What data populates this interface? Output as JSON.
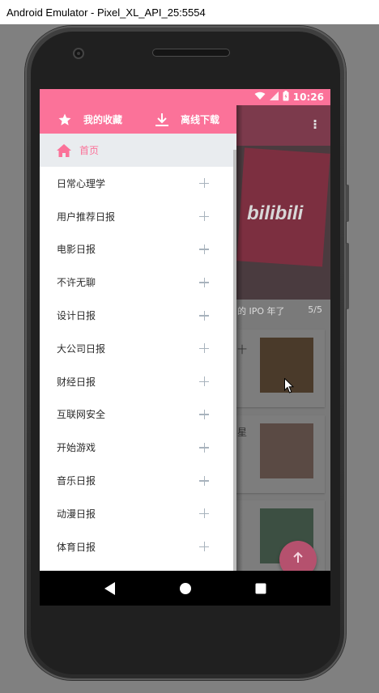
{
  "window": {
    "title": "Android Emulator - Pixel_XL_API_25:5554"
  },
  "statusbar": {
    "time": "10:26"
  },
  "drawer": {
    "header": {
      "favorites_label": "我的收藏",
      "offline_label": "离线下载"
    },
    "home_label": "首页",
    "items": [
      {
        "label": "日常心理学"
      },
      {
        "label": "用户推荐日报"
      },
      {
        "label": "电影日报"
      },
      {
        "label": "不许无聊"
      },
      {
        "label": "设计日报"
      },
      {
        "label": "大公司日报"
      },
      {
        "label": "财经日报"
      },
      {
        "label": "互联网安全"
      },
      {
        "label": "开始游戏"
      },
      {
        "label": "音乐日报"
      },
      {
        "label": "动漫日报"
      },
      {
        "label": "体育日报"
      }
    ]
  },
  "background": {
    "banner_logo": "bilibili",
    "banner_text": "的 IPO 年了",
    "banner_counter": "5/5",
    "partial_1": "十",
    "partial_2": "星"
  },
  "colors": {
    "accent": "#fb7299",
    "home_bg": "#e9ecef",
    "plus": "#a8b3bd"
  },
  "icons": {
    "favorites": "star-icon",
    "offline": "download-icon",
    "home": "home-icon",
    "add": "plus-icon",
    "fab": "arrow-up-icon"
  }
}
